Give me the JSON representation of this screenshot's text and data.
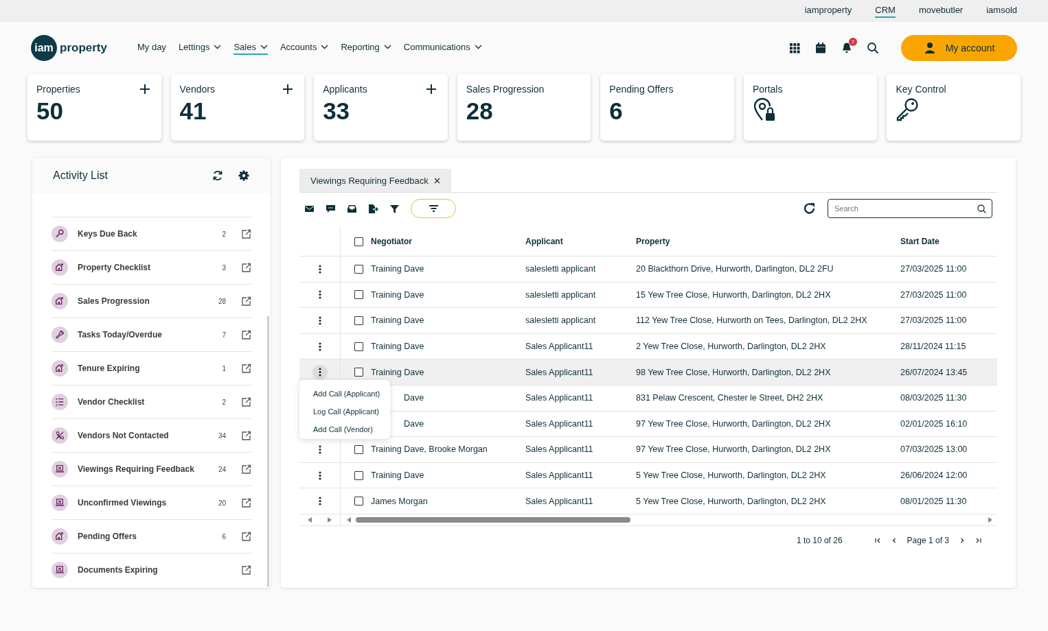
{
  "top_links": [
    {
      "label": "iamproperty",
      "selected": false
    },
    {
      "label": "CRM",
      "selected": true
    },
    {
      "label": "movebutler",
      "selected": false
    },
    {
      "label": "iamsold",
      "selected": false
    }
  ],
  "logo": {
    "mark": "iam",
    "word": "property"
  },
  "nav": [
    {
      "label": "My day",
      "dropdown": false,
      "selected": false
    },
    {
      "label": "Lettings",
      "dropdown": true,
      "selected": false
    },
    {
      "label": "Sales",
      "dropdown": true,
      "selected": true
    },
    {
      "label": "Accounts",
      "dropdown": true,
      "selected": false
    },
    {
      "label": "Reporting",
      "dropdown": true,
      "selected": false
    },
    {
      "label": "Communications",
      "dropdown": true,
      "selected": false
    }
  ],
  "notification_count": "7",
  "account_button": "My account",
  "stat_cards": [
    {
      "label": "Properties",
      "kind": "count",
      "value": "50",
      "add": true
    },
    {
      "label": "Vendors",
      "kind": "count",
      "value": "41",
      "add": true
    },
    {
      "label": "Applicants",
      "kind": "count",
      "value": "33",
      "add": true
    },
    {
      "label": "Sales Progression",
      "kind": "count",
      "value": "28",
      "add": false
    },
    {
      "label": "Pending Offers",
      "kind": "count",
      "value": "6",
      "add": false
    },
    {
      "label": "Portals",
      "kind": "pin_lock",
      "add": false
    },
    {
      "label": "Key Control",
      "kind": "key",
      "add": false
    }
  ],
  "activity_list": {
    "title": "Activity List",
    "items": [
      {
        "label": "Keys Due Back",
        "count": "2",
        "kind": "key"
      },
      {
        "label": "Property Checklist",
        "count": "3",
        "kind": "house"
      },
      {
        "label": "Sales Progression",
        "count": "28",
        "kind": "house"
      },
      {
        "label": "Tasks Today/Overdue",
        "count": "7",
        "kind": "wrench"
      },
      {
        "label": "Tenure Expiring",
        "count": "1",
        "kind": "house"
      },
      {
        "label": "Vendor Checklist",
        "count": "2",
        "kind": "checklist"
      },
      {
        "label": "Vendors Not Contacted",
        "count": "34",
        "kind": "phone_off"
      },
      {
        "label": "Viewings Requiring Feedback",
        "count": "24",
        "kind": "viewing"
      },
      {
        "label": "Unconfirmed Viewings",
        "count": "20",
        "kind": "viewing"
      },
      {
        "label": "Pending Offers",
        "count": "6",
        "kind": "house"
      },
      {
        "label": "Documents Expiring",
        "kind": "viewing"
      }
    ]
  },
  "tabs": [
    {
      "label": "Viewings Requiring Feedback",
      "selected": true,
      "closable": true
    }
  ],
  "toolbar": {
    "filter_active": true,
    "search": {
      "placeholder": "Search"
    }
  },
  "table": {
    "all_checked": false,
    "columns": [
      "Negotiator",
      "Applicant",
      "Property",
      "Start Date"
    ],
    "rows": [
      {
        "cells": [
          "Training Dave",
          "salesletti applicant",
          "20 Blackthorn Drive, Hurworth, Darlington, DL2 2FU",
          "27/03/2025 11:00"
        ],
        "checked": false,
        "highlighted": false,
        "menu_open": false,
        "covered": false
      },
      {
        "cells": [
          "Training Dave",
          "salesletti applicant",
          "15 Yew Tree Close, Hurworth, Darlington, DL2 2HX",
          "27/03/2025 11:00"
        ],
        "checked": false,
        "highlighted": false,
        "menu_open": false,
        "covered": false
      },
      {
        "cells": [
          "Training Dave",
          "salesletti applicant",
          "112 Yew Tree Close, Hurworth on Tees, Darlington, DL2 2HX",
          "27/03/2025 11:00"
        ],
        "checked": false,
        "highlighted": false,
        "menu_open": false,
        "covered": false
      },
      {
        "cells": [
          "Training Dave",
          "Sales Applicant11",
          "2 Yew Tree Close, Hurworth, Darlington, DL2 2HX",
          "28/11/2024 11:15"
        ],
        "checked": false,
        "highlighted": false,
        "menu_open": false,
        "covered": false
      },
      {
        "cells": [
          "Training Dave",
          "Sales Applicant11",
          "98 Yew Tree Close, Hurworth, Darlington, DL2 2HX",
          "26/07/2024 13:45"
        ],
        "checked": false,
        "highlighted": true,
        "menu_open": true,
        "covered": false
      },
      {
        "cells": [
          "Dave",
          "Sales Applicant11",
          "831 Pelaw Crescent, Chester le Street, DH2 2HX",
          "08/03/2025 11:30"
        ],
        "highlighted": false,
        "covered": true
      },
      {
        "cells": [
          "Dave",
          "Sales Applicant11",
          "97 Yew Tree Close, Hurworth, Darlington, DL2 2HX",
          "02/01/2025 16:10"
        ],
        "highlighted": false,
        "covered": true
      },
      {
        "cells": [
          "Training Dave, Brooke Morgan",
          "Sales Applicant11",
          "97 Yew Tree Close, Hurworth, Darlington, DL2 2HX",
          "07/03/2025 13:00"
        ],
        "checked": false,
        "highlighted": false,
        "menu_open": false,
        "covered": false
      },
      {
        "cells": [
          "Training Dave",
          "Sales Applicant11",
          "5 Yew Tree Close, Hurworth, Darlington, DL2 2HX",
          "26/06/2024 12:00"
        ],
        "checked": false,
        "highlighted": false,
        "menu_open": false,
        "covered": false
      },
      {
        "cells": [
          "James Morgan",
          "Sales Applicant11",
          "5 Yew Tree Close, Hurworth, Darlington, DL2 2HX",
          "08/01/2025 11:30"
        ],
        "checked": false,
        "highlighted": false,
        "menu_open": false,
        "covered": false
      }
    ]
  },
  "row_menu": {
    "items": [
      "Add Call (Applicant)",
      "Log Call (Applicant)",
      "Add Call (Vendor)"
    ]
  },
  "pagination": {
    "range": "1 to 10 of 26",
    "page": "Page 1 of 3"
  }
}
